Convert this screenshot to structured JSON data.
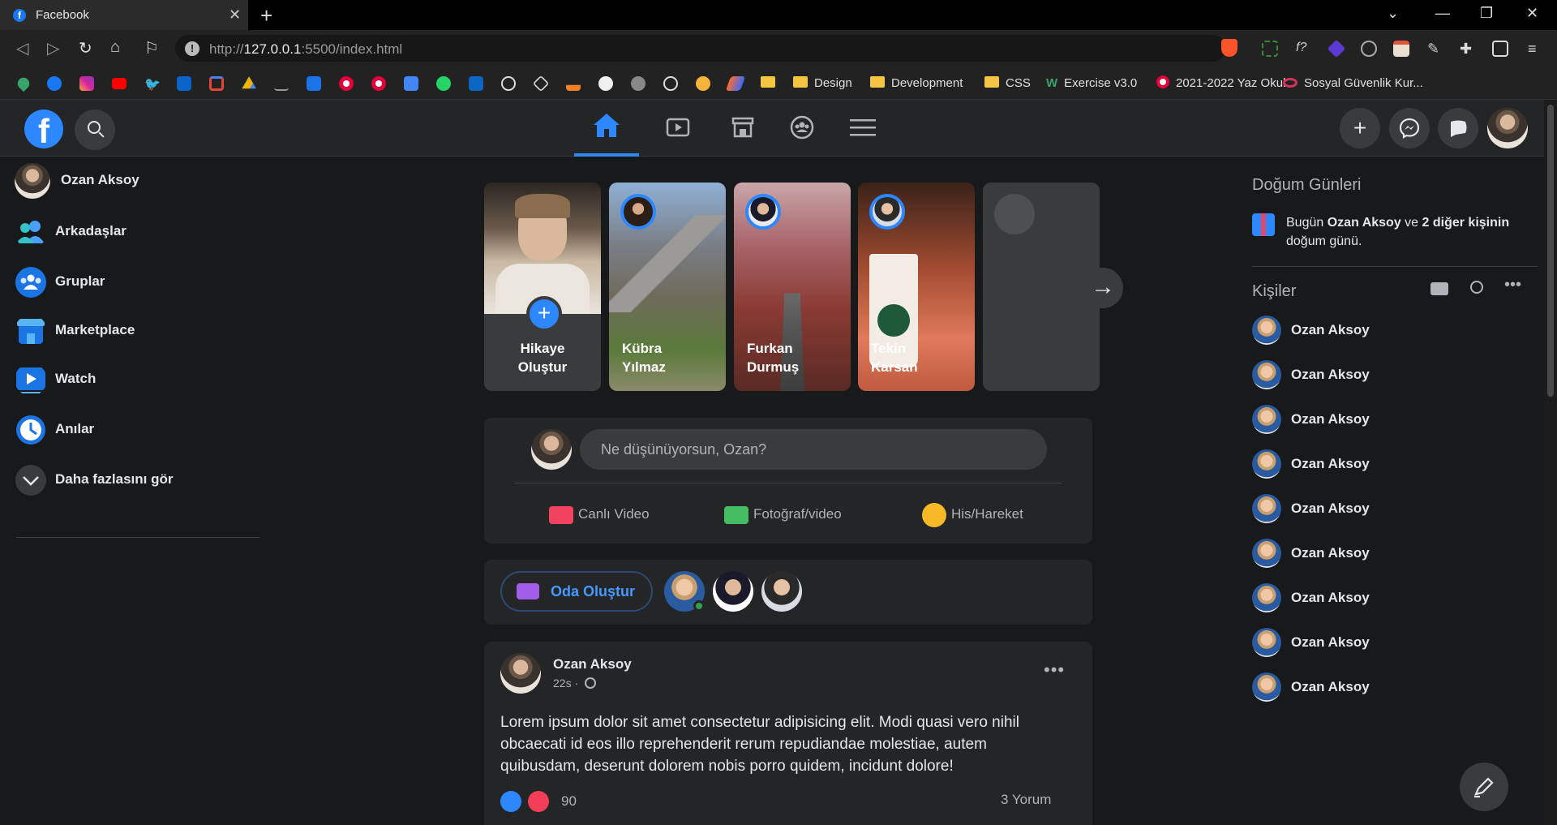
{
  "browser": {
    "tab_title": "Facebook",
    "url_prefix": "http://",
    "url_host": "127.0.0.1",
    "url_rest": ":5500/index.html",
    "bookmarks": [
      "Design",
      "Development",
      "CSS",
      "Exercise v3.0",
      "2021-2022 Yaz Okul...",
      "Sosyal Güvenlik Kur..."
    ]
  },
  "user": {
    "name": "Ozan Aksoy"
  },
  "sidebar": {
    "items": [
      {
        "label": "Ozan Aksoy",
        "icon": "profile-avatar"
      },
      {
        "label": "Arkadaşlar",
        "icon": "friends-icon"
      },
      {
        "label": "Gruplar",
        "icon": "groups-icon"
      },
      {
        "label": "Marketplace",
        "icon": "marketplace-icon"
      },
      {
        "label": "Watch",
        "icon": "watch-icon"
      },
      {
        "label": "Anılar",
        "icon": "memories-icon"
      },
      {
        "label": "Daha fazlasını gör",
        "icon": "chevron-down-icon"
      }
    ]
  },
  "stories": [
    {
      "line1": "Hikaye",
      "line2": "Oluştur"
    },
    {
      "line1": "Kübra",
      "line2": "Yılmaz"
    },
    {
      "line1": "Furkan",
      "line2": "Durmuş"
    },
    {
      "line1": "Tekin",
      "line2": "Karsan"
    }
  ],
  "composer": {
    "placeholder": "Ne düşünüyorsun, Ozan?",
    "actions": [
      "Canlı Video",
      "Fotoğraf/video",
      "His/Hareket"
    ]
  },
  "rooms": {
    "button_label": "Oda Oluştur"
  },
  "post": {
    "author": "Ozan Aksoy",
    "time": "22s ·",
    "text": "Lorem ipsum dolor sit amet consectetur adipisicing elit. Modi quasi vero nihil obcaecati id eos illo reprehenderit rerum repudiandae molestiae, autem quibusdam, deserunt dolorem nobis porro quidem, incidunt dolore!",
    "reaction_count": "90",
    "comments": "3 Yorum"
  },
  "birthdays": {
    "heading": "Doğum Günleri",
    "text_prefix": "Bugün ",
    "name": "Ozan Aksoy",
    "text_mid": " ve ",
    "others": "2 diğer kişinin",
    "text_suffix": " doğum günü."
  },
  "contacts": {
    "heading": "Kişiler",
    "list": [
      "Ozan Aksoy",
      "Ozan Aksoy",
      "Ozan Aksoy",
      "Ozan Aksoy",
      "Ozan Aksoy",
      "Ozan Aksoy",
      "Ozan Aksoy",
      "Ozan Aksoy",
      "Ozan Aksoy"
    ]
  },
  "colors": {
    "accent": "#2d88ff",
    "bg": "#18191a",
    "card": "#242526"
  }
}
